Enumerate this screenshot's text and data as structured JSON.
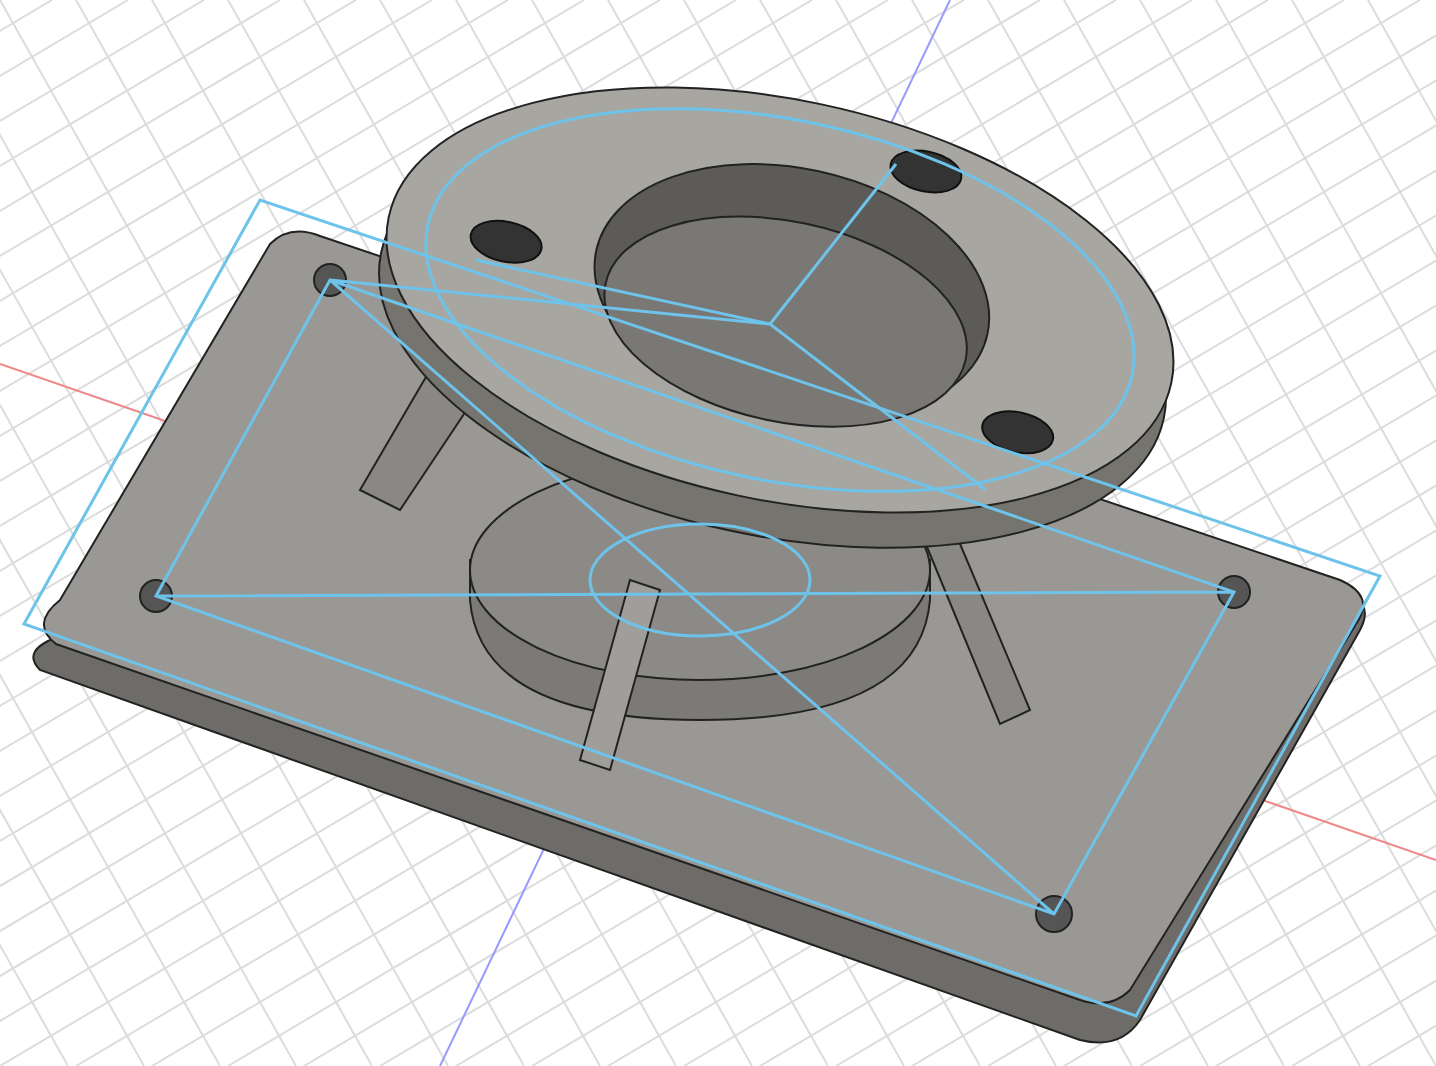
{
  "viewport": {
    "kind": "cad-model",
    "grid": true
  }
}
